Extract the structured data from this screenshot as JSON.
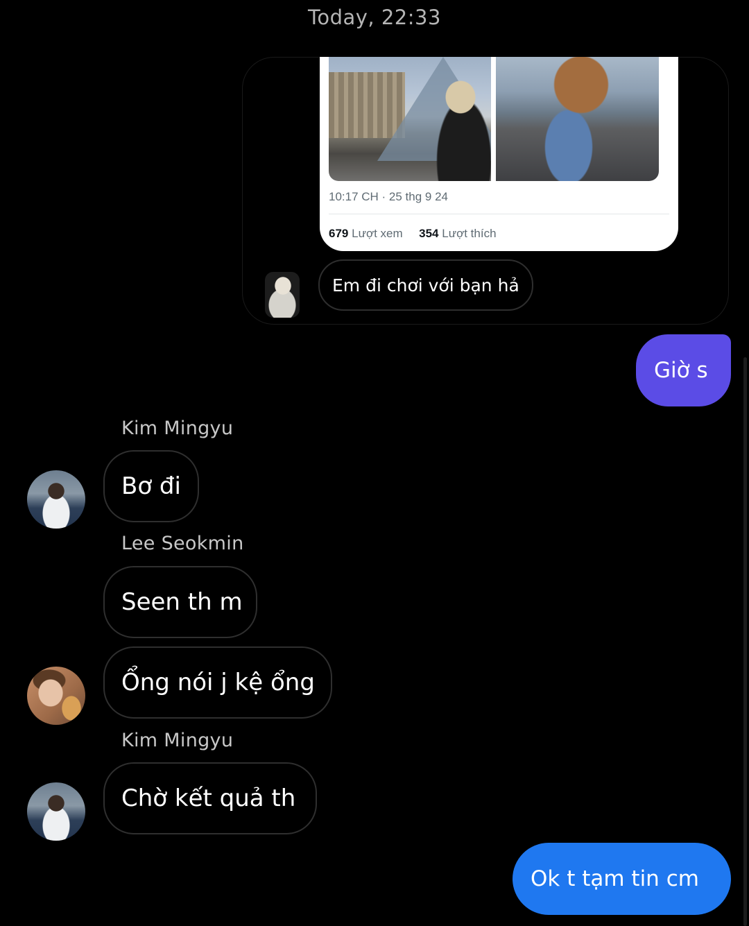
{
  "header": {
    "timestamp": "Today, 22:33"
  },
  "shared_post": {
    "time_date": "10:17 CH · 25 thg 9 24",
    "views_count": "679",
    "views_label": "Lượt xem",
    "likes_count": "354",
    "likes_label": "Lượt thích"
  },
  "reply_message": {
    "text": "Em đi chơi với bạn hả"
  },
  "messages": [
    {
      "kind": "outgoing",
      "text": "Giờ s",
      "color": "#5b4ce6"
    },
    {
      "kind": "incoming",
      "sender": "Kim Mingyu",
      "text": "Bơ đi"
    },
    {
      "kind": "incoming",
      "sender": "Lee Seokmin",
      "text": "Seen th m"
    },
    {
      "kind": "incoming",
      "text": "Ổng nói j kệ ổng"
    },
    {
      "kind": "incoming",
      "sender": "Kim Mingyu",
      "text": "Chờ kết quả th"
    },
    {
      "kind": "outgoing",
      "text": "Ok t tạm tin cm",
      "color": "#1f78f0"
    }
  ],
  "colors": {
    "background": "#000000",
    "incoming_border": "#2f2f2f",
    "outgoing_purple": "#5b4ce6",
    "outgoing_blue": "#1f78f0"
  }
}
